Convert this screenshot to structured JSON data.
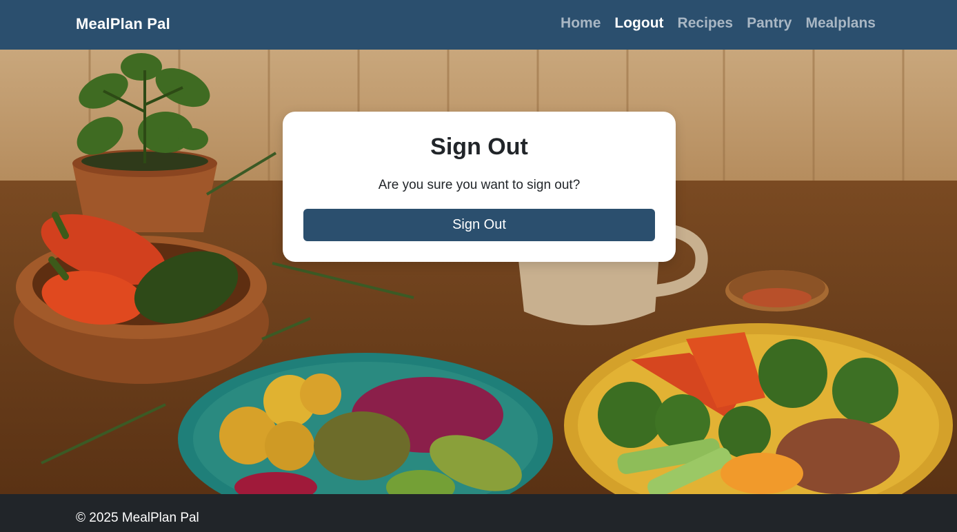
{
  "navbar": {
    "brand": "MealPlan Pal",
    "links": [
      {
        "label": "Home",
        "active": false
      },
      {
        "label": "Logout",
        "active": true
      },
      {
        "label": "Recipes",
        "active": false
      },
      {
        "label": "Pantry",
        "active": false
      },
      {
        "label": "Mealplans",
        "active": false
      }
    ]
  },
  "signout_card": {
    "title": "Sign Out",
    "message": "Are you sure you want to sign out?",
    "button_label": "Sign Out"
  },
  "footer": {
    "text": "© 2025 MealPlan Pal"
  },
  "colors": {
    "primary": "#2b4f6e",
    "nav_inactive": "#a9b7c4",
    "footer_bg": "#212529"
  }
}
